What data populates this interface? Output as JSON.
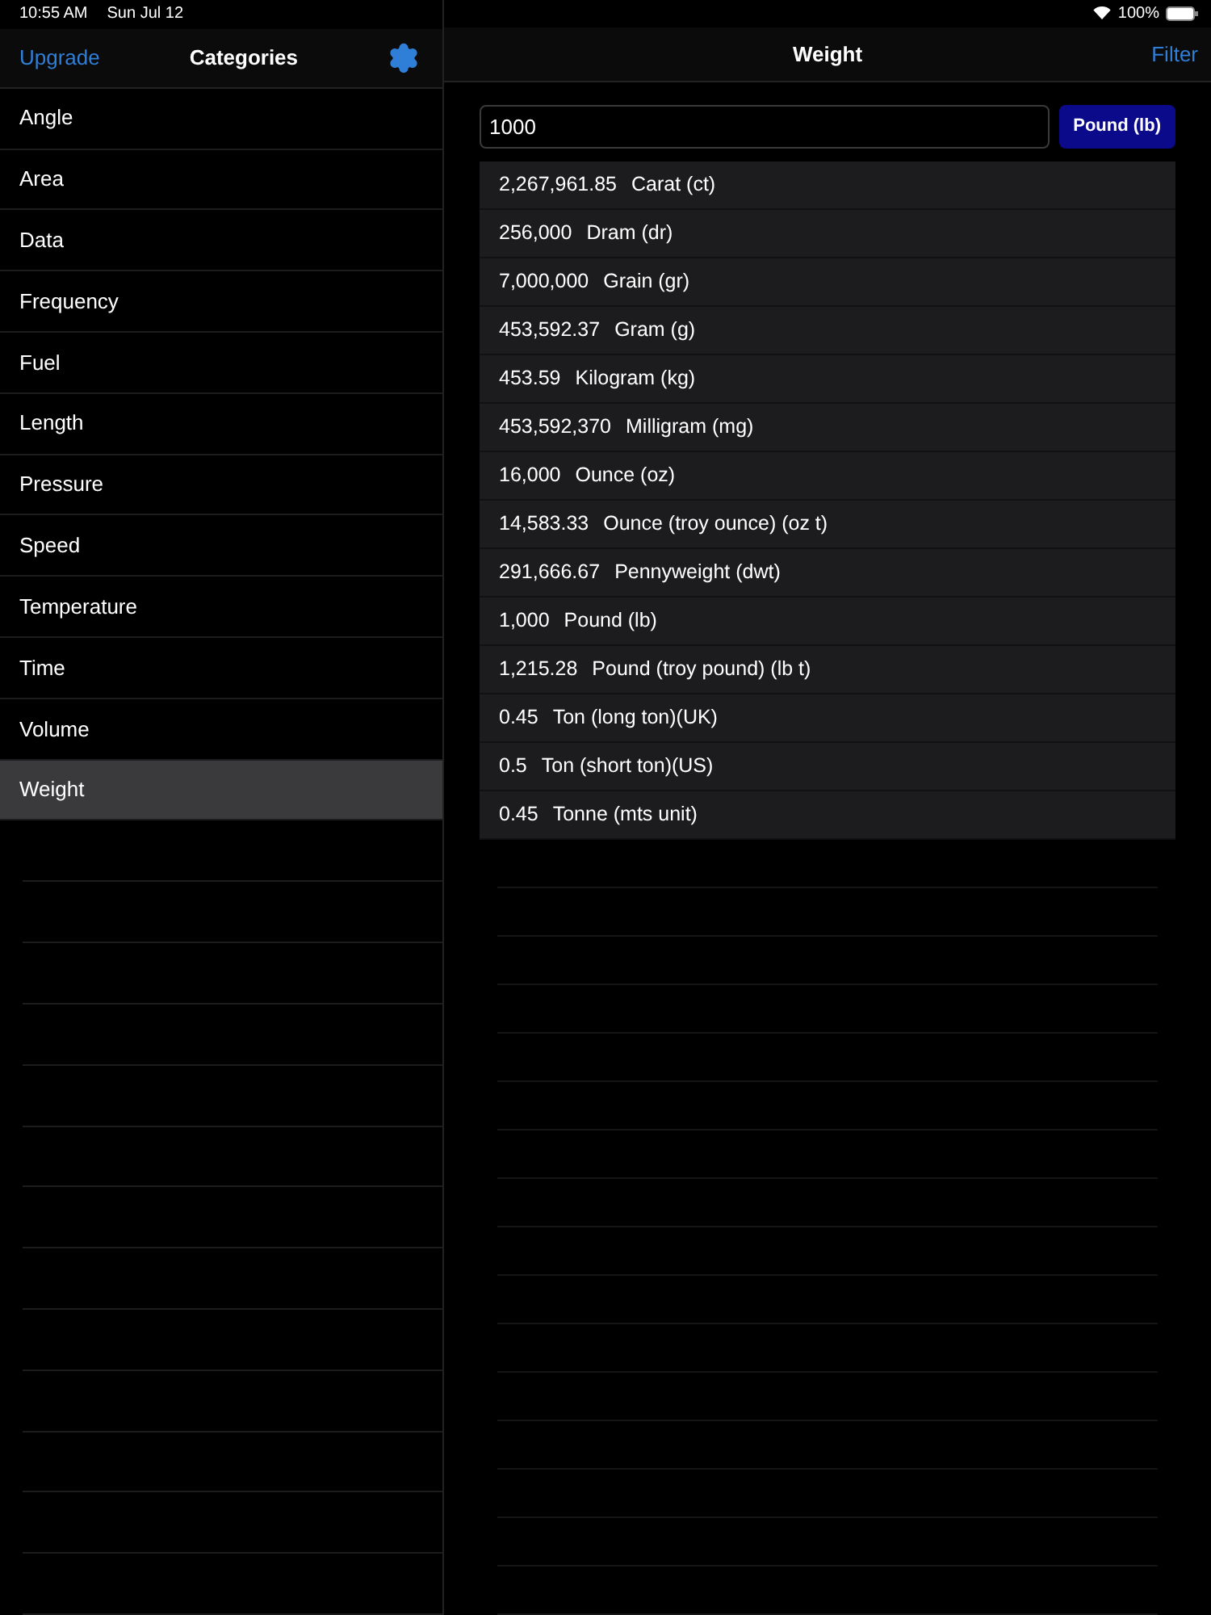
{
  "status_bar": {
    "time": "10:55 AM",
    "date": "Sun Jul 12",
    "battery": "100%"
  },
  "sidebar": {
    "upgrade": "Upgrade",
    "title": "Categories",
    "items": [
      {
        "label": "Angle",
        "selected": false
      },
      {
        "label": "Area",
        "selected": false
      },
      {
        "label": "Data",
        "selected": false
      },
      {
        "label": "Frequency",
        "selected": false
      },
      {
        "label": "Fuel",
        "selected": false
      },
      {
        "label": "Length",
        "selected": false
      },
      {
        "label": "Pressure",
        "selected": false
      },
      {
        "label": "Speed",
        "selected": false
      },
      {
        "label": "Temperature",
        "selected": false
      },
      {
        "label": "Time",
        "selected": false
      },
      {
        "label": "Volume",
        "selected": false
      },
      {
        "label": "Weight",
        "selected": true
      }
    ]
  },
  "detail": {
    "title": "Weight",
    "filter": "Filter",
    "input": "1000",
    "unit_button": "Pound (lb)",
    "results": [
      {
        "value": "2,267,961.85",
        "unit": "Carat (ct)"
      },
      {
        "value": "256,000",
        "unit": "Dram (dr)"
      },
      {
        "value": "7,000,000",
        "unit": "Grain (gr)"
      },
      {
        "value": "453,592.37",
        "unit": "Gram (g)"
      },
      {
        "value": "453.59",
        "unit": "Kilogram (kg)"
      },
      {
        "value": "453,592,370",
        "unit": "Milligram (mg)"
      },
      {
        "value": "16,000",
        "unit": "Ounce (oz)"
      },
      {
        "value": "14,583.33",
        "unit": "Ounce (troy ounce) (oz t)"
      },
      {
        "value": "291,666.67",
        "unit": "Pennyweight (dwt)"
      },
      {
        "value": "1,000",
        "unit": "Pound (lb)"
      },
      {
        "value": "1,215.28",
        "unit": "Pound (troy pound) (lb t)"
      },
      {
        "value": "0.45",
        "unit": "Ton (long ton)(UK)"
      },
      {
        "value": "0.5",
        "unit": "Ton (short ton)(US)"
      },
      {
        "value": "0.45",
        "unit": "Tonne (mts unit)"
      }
    ]
  }
}
